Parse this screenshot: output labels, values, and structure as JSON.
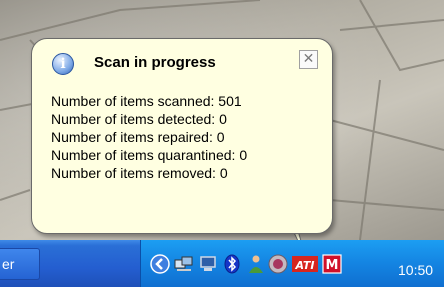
{
  "balloon": {
    "title": "Scan in progress",
    "close_label": "✕",
    "lines": [
      "Number of items scanned: 501",
      "Number of items detected: 0",
      "Number of items repaired: 0",
      "Number of items quarantined: 0",
      "Number of items removed: 0"
    ]
  },
  "taskbar": {
    "button_text": "er",
    "clock": "10:50",
    "tray_icons": [
      "show-hidden-icons-icon",
      "network-icon",
      "monitor-icon",
      "bluetooth-icon",
      "user-icon",
      "antivirus-icon",
      "ati-icon",
      "m-icon"
    ]
  },
  "colors": {
    "balloon_bg": "#ffffe1",
    "taskbar": "#245ed0",
    "tray": "#1484e2"
  }
}
